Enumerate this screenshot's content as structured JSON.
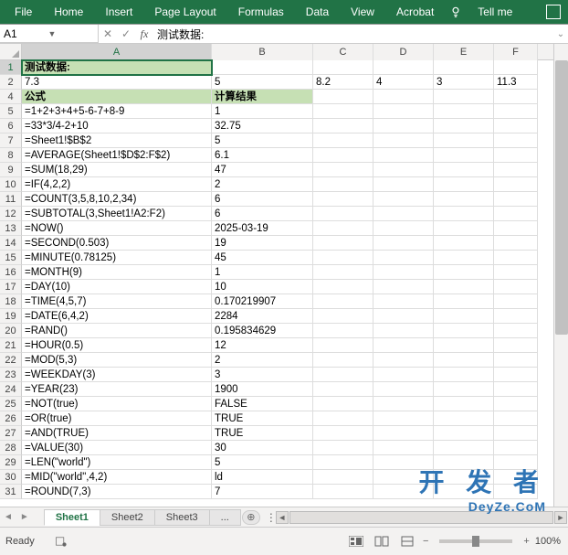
{
  "ribbon": {
    "tabs": [
      "File",
      "Home",
      "Insert",
      "Page Layout",
      "Formulas",
      "Data",
      "View",
      "Acrobat"
    ],
    "tellme": "Tell me"
  },
  "namebox": "A1",
  "formula": "测试数据:",
  "columns": [
    "A",
    "B",
    "C",
    "D",
    "E",
    "F"
  ],
  "rows": [
    {
      "n": 1,
      "A": "测试数据:",
      "hdr": true,
      "active": true
    },
    {
      "n": 2,
      "A": "7.3",
      "B": "5",
      "C": "8.2",
      "D": "4",
      "E": "3",
      "F": "11.3",
      "numall": true
    },
    {
      "n": 4,
      "A": "公式",
      "B": "计算结果",
      "hdr2": true
    },
    {
      "n": 5,
      "A": "=1+2+3+4+5-6-7+8-9",
      "B": "1"
    },
    {
      "n": 6,
      "A": "=33*3/4-2+10",
      "B": "32.75"
    },
    {
      "n": 7,
      "A": "=Sheet1!$B$2",
      "B": "5"
    },
    {
      "n": 8,
      "A": "=AVERAGE(Sheet1!$D$2:F$2)",
      "B": "6.1"
    },
    {
      "n": 9,
      "A": "=SUM(18,29)",
      "B": "47"
    },
    {
      "n": 10,
      "A": "=IF(4,2,2)",
      "B": "2"
    },
    {
      "n": 11,
      "A": "=COUNT(3,5,8,10,2,34)",
      "B": "6"
    },
    {
      "n": 12,
      "A": "=SUBTOTAL(3,Sheet1!A2:F2)",
      "B": "6"
    },
    {
      "n": 13,
      "A": "=NOW()",
      "B": "2025-03-19"
    },
    {
      "n": 14,
      "A": "=SECOND(0.503)",
      "B": "19"
    },
    {
      "n": 15,
      "A": "=MINUTE(0.78125)",
      "B": "45"
    },
    {
      "n": 16,
      "A": "=MONTH(9)",
      "B": "1"
    },
    {
      "n": 17,
      "A": "=DAY(10)",
      "B": "10"
    },
    {
      "n": 18,
      "A": "=TIME(4,5,7)",
      "B": "0.170219907"
    },
    {
      "n": 19,
      "A": "=DATE(6,4,2)",
      "B": "2284"
    },
    {
      "n": 20,
      "A": "=RAND()",
      "B": "0.195834629"
    },
    {
      "n": 21,
      "A": "=HOUR(0.5)",
      "B": "12"
    },
    {
      "n": 22,
      "A": "=MOD(5,3)",
      "B": "2"
    },
    {
      "n": 23,
      "A": "=WEEKDAY(3)",
      "B": "3"
    },
    {
      "n": 24,
      "A": "=YEAR(23)",
      "B": "1900"
    },
    {
      "n": 25,
      "A": "=NOT(true)",
      "B": "FALSE"
    },
    {
      "n": 26,
      "A": "=OR(true)",
      "B": "TRUE"
    },
    {
      "n": 27,
      "A": "=AND(TRUE)",
      "B": "TRUE"
    },
    {
      "n": 28,
      "A": "=VALUE(30)",
      "B": "30"
    },
    {
      "n": 29,
      "A": "=LEN(\"world\")",
      "B": "5"
    },
    {
      "n": 30,
      "A": "=MID(\"world\",4,2)",
      "B": "ld"
    },
    {
      "n": 31,
      "A": "=ROUND(7,3)",
      "B": "7"
    }
  ],
  "tabs": {
    "items": [
      "Sheet1",
      "Sheet2",
      "Sheet3"
    ],
    "active": 0,
    "ellipsis": "...",
    "add": "⊕"
  },
  "status": {
    "ready": "Ready",
    "zoom": "100%"
  },
  "watermark": {
    "line1": "开 发 者",
    "line2": "DeyZe.CoM"
  }
}
